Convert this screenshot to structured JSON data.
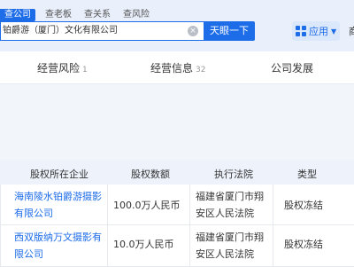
{
  "tabs": [
    {
      "label": "查公司",
      "active": true
    },
    {
      "label": "查老板"
    },
    {
      "label": "查关系"
    },
    {
      "label": "查风险"
    }
  ],
  "search": {
    "value": "铂爵游（厦门）文化有限公司",
    "button": "天眼一下"
  },
  "apps": {
    "label": "应用",
    "edge_char": "商"
  },
  "nav": [
    {
      "label": "经营风险",
      "count": "1"
    },
    {
      "label": "经营信息",
      "count": "32"
    },
    {
      "label": "公司发展"
    }
  ],
  "table": {
    "headers": [
      "股权所在企业",
      "股权数额",
      "执行法院",
      "类型"
    ],
    "rows": [
      {
        "company_line1": "海南陵水铂爵游摄影",
        "company_line2": "有限公司",
        "amount": "100.0万人民币",
        "court_line1": "福建省厦门市翔",
        "court_line2": "安区人民法院",
        "type": "股权冻结"
      },
      {
        "company_line1": "西双版纳万文摄影有",
        "company_line2": "限公司",
        "amount": "10.0万人民币",
        "court_line1": "福建省厦门市翔",
        "court_line2": "安区人民法院",
        "type": "股权冻结"
      }
    ]
  },
  "colors": {
    "accent": "#1d6ce8",
    "topbar": "#e9f0fb"
  }
}
